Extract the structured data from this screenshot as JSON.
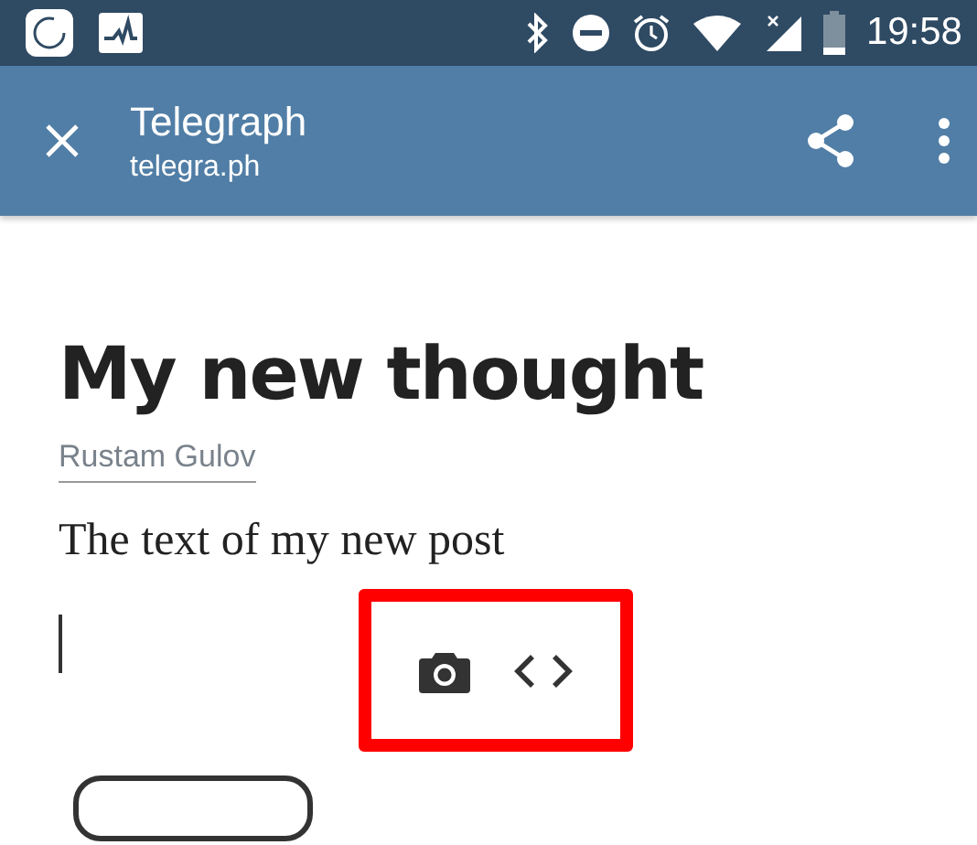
{
  "status_bar": {
    "time": "19:58"
  },
  "toolbar": {
    "title": "Telegraph",
    "url": "telegra.ph"
  },
  "article": {
    "title": "My new thought",
    "author": "Rustam Gulov",
    "body": "The text of my new post"
  }
}
